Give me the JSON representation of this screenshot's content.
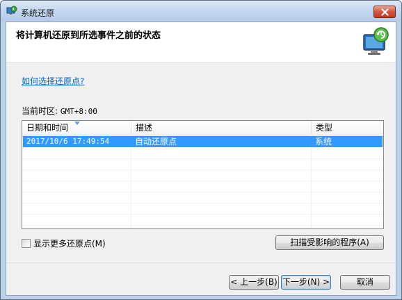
{
  "window": {
    "title": "系统还原"
  },
  "header": {
    "heading": "将计算机还原到所选事件之前的状态"
  },
  "help_link": "如何选择还原点?",
  "timezone": {
    "label": "当前时区: ",
    "value": "GMT+8:00"
  },
  "list": {
    "columns": [
      "日期和时间",
      "描述",
      "类型"
    ],
    "sorted_column": "日期和时间",
    "rows": [
      {
        "date": "2017/10/6 17:49:54",
        "description": "自动还原点",
        "type": "系统",
        "selected": true
      }
    ]
  },
  "show_more_checkbox": {
    "label": "显示更多还原点(M)",
    "checked": false
  },
  "buttons": {
    "scan": "扫描受影响的程序(A)",
    "back": "< 上一步(B)",
    "next": "下一步(N) >",
    "cancel": "取消"
  },
  "icons": {
    "title_icon": "system-restore-icon",
    "header_icon": "system-restore-monitor-icon",
    "close_icon": "close-icon",
    "sort_icon": "sort-arrow-icon"
  },
  "colors": {
    "selection": "#3399ff",
    "link": "#0066cc",
    "close_button": "#c33b22"
  }
}
